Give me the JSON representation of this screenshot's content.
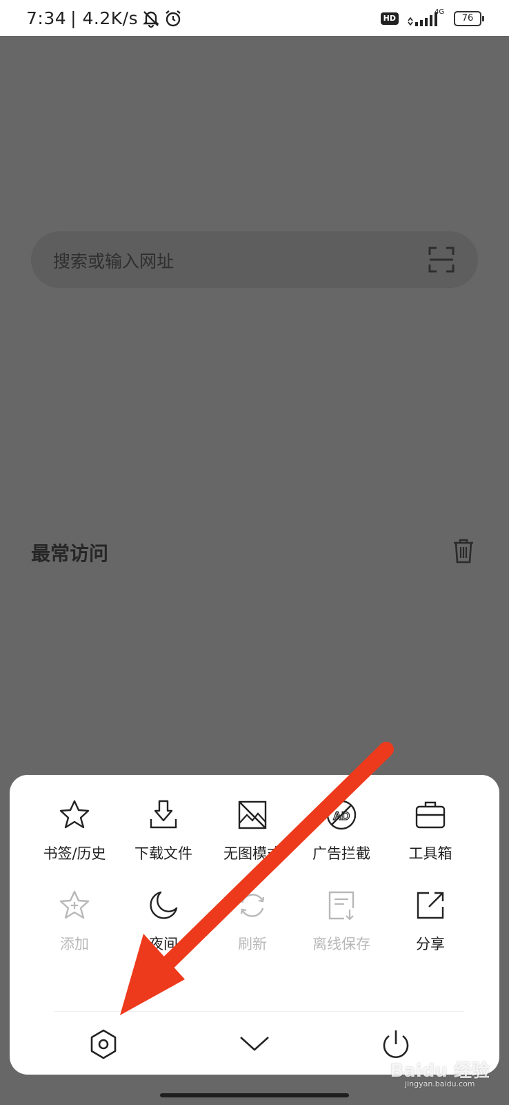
{
  "status_bar": {
    "time": "7:34",
    "speed": "| 4.2K/s",
    "hd_badge": "HD",
    "network_type": "4G",
    "battery": "76"
  },
  "search": {
    "placeholder": "搜索或输入网址"
  },
  "most_visited": {
    "title": "最常访问"
  },
  "menu": {
    "row1": [
      {
        "label": "书签/历史",
        "icon": "star-icon",
        "disabled": false
      },
      {
        "label": "下载文件",
        "icon": "download-icon",
        "disabled": false
      },
      {
        "label": "无图模式",
        "icon": "no-image-icon",
        "disabled": false
      },
      {
        "label": "广告拦截",
        "icon": "ad-block-icon",
        "disabled": false
      },
      {
        "label": "工具箱",
        "icon": "toolbox-icon",
        "disabled": false
      }
    ],
    "row2": [
      {
        "label": "添加",
        "icon": "add-star-icon",
        "disabled": true
      },
      {
        "label": "夜间",
        "icon": "moon-icon",
        "disabled": false
      },
      {
        "label": "刷新",
        "icon": "refresh-icon",
        "disabled": true
      },
      {
        "label": "离线保存",
        "icon": "offline-save-icon",
        "disabled": true
      },
      {
        "label": "分享",
        "icon": "share-icon",
        "disabled": false
      }
    ],
    "bottom": {
      "settings_icon": "settings-hex-icon",
      "collapse_icon": "chevron-down-icon",
      "exit_icon": "power-icon"
    }
  },
  "annotation": {
    "arrow_color": "#ee3a1c"
  },
  "watermark": {
    "text": "Baidu 经验",
    "sub": "jingyan.baidu.com"
  },
  "colors": {
    "overlay": "#676767",
    "sheet": "#ffffff"
  }
}
